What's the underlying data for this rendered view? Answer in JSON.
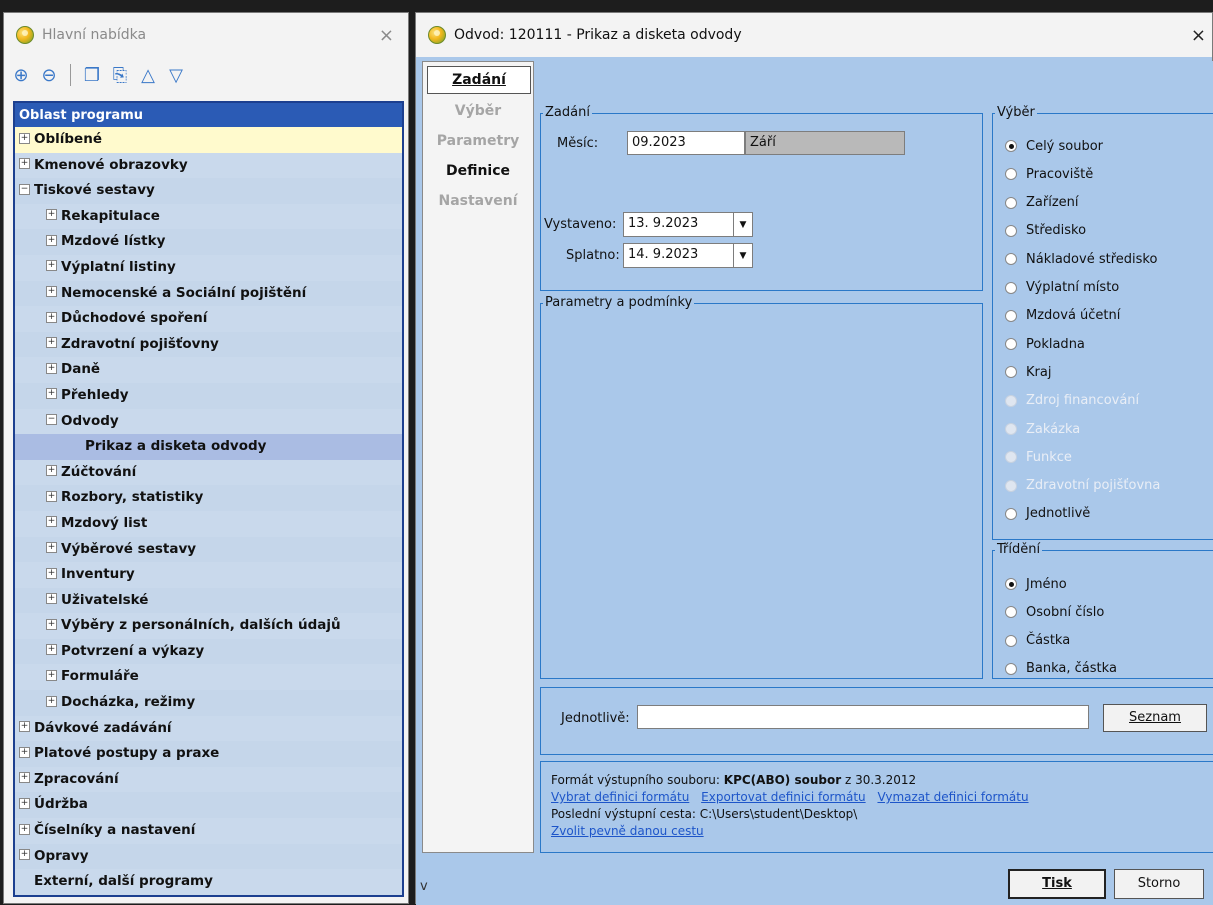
{
  "left_window": {
    "title": "Hlavní nabídka",
    "close": "×",
    "toolbar": [
      "expand-all-icon",
      "collapse-all-icon",
      "add-favorite-icon",
      "edit-favorite-icon",
      "move-up-icon",
      "move-down-icon"
    ],
    "tree_header": "Oblast programu",
    "tree": [
      {
        "label": "Oblíbené",
        "level": 0,
        "sign": "+"
      },
      {
        "label": "Kmenové obrazovky",
        "level": 0,
        "sign": "+"
      },
      {
        "label": "Tiskové sestavy",
        "level": 0,
        "sign": "−"
      },
      {
        "label": "Rekapitulace",
        "level": 1,
        "sign": "+"
      },
      {
        "label": "Mzdové lístky",
        "level": 1,
        "sign": "+"
      },
      {
        "label": "Výplatní listiny",
        "level": 1,
        "sign": "+"
      },
      {
        "label": "Nemocenské a Sociální pojištění",
        "level": 1,
        "sign": "+"
      },
      {
        "label": "Důchodové spoření",
        "level": 1,
        "sign": "+"
      },
      {
        "label": "Zdravotní pojišťovny",
        "level": 1,
        "sign": "+"
      },
      {
        "label": "Daně",
        "level": 1,
        "sign": "+"
      },
      {
        "label": "Přehledy",
        "level": 1,
        "sign": "+"
      },
      {
        "label": "Odvody",
        "level": 1,
        "sign": "−"
      },
      {
        "label": "Prikaz a disketa odvody",
        "level": 2,
        "sign": ""
      },
      {
        "label": "Zúčtování",
        "level": 1,
        "sign": "+"
      },
      {
        "label": "Rozbory, statistiky",
        "level": 1,
        "sign": "+"
      },
      {
        "label": "Mzdový list",
        "level": 1,
        "sign": "+"
      },
      {
        "label": "Výběrové sestavy",
        "level": 1,
        "sign": "+"
      },
      {
        "label": "Inventury",
        "level": 1,
        "sign": "+"
      },
      {
        "label": "Uživatelské",
        "level": 1,
        "sign": "+"
      },
      {
        "label": "Výběry z personálních, dalších údajů",
        "level": 1,
        "sign": "+"
      },
      {
        "label": "Potvrzení a výkazy",
        "level": 1,
        "sign": "+"
      },
      {
        "label": "Formuláře",
        "level": 1,
        "sign": "+"
      },
      {
        "label": "Docházka, režimy",
        "level": 1,
        "sign": "+"
      },
      {
        "label": "Dávkové zadávání",
        "level": 0,
        "sign": "+"
      },
      {
        "label": "Platové postupy a praxe",
        "level": 0,
        "sign": "+"
      },
      {
        "label": "Zpracování",
        "level": 0,
        "sign": "+"
      },
      {
        "label": "Údržba",
        "level": 0,
        "sign": "+"
      },
      {
        "label": "Číselníky a nastavení",
        "level": 0,
        "sign": "+"
      },
      {
        "label": "Opravy",
        "level": 0,
        "sign": "+"
      },
      {
        "label": "Externí, další programy",
        "level": 0,
        "sign": ""
      }
    ]
  },
  "dialog": {
    "title": "Odvod: 120111 - Prikaz a disketa odvody",
    "close": "×",
    "tabs": [
      "Zadání",
      "Výběr",
      "Parametry",
      "Definice",
      "Nastavení"
    ],
    "zadani": {
      "group_label": "Zadání",
      "mesic_label": "Měsíc:",
      "mesic_value": "09.2023",
      "mesic_name": "Září",
      "vystaveno_label": "Vystaveno:",
      "vystaveno_value": "13. 9.2023",
      "splatno_label": "Splatno:",
      "splatno_value": "14. 9.2023"
    },
    "parametry_label": "Parametry a podmínky",
    "vyber": {
      "group_label": "Výběr",
      "options": [
        {
          "label": "Celý soubor",
          "checked": true,
          "enabled": true
        },
        {
          "label": "Pracoviště",
          "checked": false,
          "enabled": true
        },
        {
          "label": "Zařízení",
          "checked": false,
          "enabled": true
        },
        {
          "label": "Středisko",
          "checked": false,
          "enabled": true
        },
        {
          "label": "Nákladové středisko",
          "checked": false,
          "enabled": true
        },
        {
          "label": "Výplatní místo",
          "checked": false,
          "enabled": true
        },
        {
          "label": "Mzdová účetní",
          "checked": false,
          "enabled": true
        },
        {
          "label": "Pokladna",
          "checked": false,
          "enabled": true
        },
        {
          "label": "Kraj",
          "checked": false,
          "enabled": true
        },
        {
          "label": "Zdroj financování",
          "checked": false,
          "enabled": false
        },
        {
          "label": "Zakázka",
          "checked": false,
          "enabled": false
        },
        {
          "label": "Funkce",
          "checked": false,
          "enabled": false
        },
        {
          "label": "Zdravotní pojišťovna",
          "checked": false,
          "enabled": false
        },
        {
          "label": "Jednotlivě",
          "checked": false,
          "enabled": true
        }
      ]
    },
    "trideni": {
      "group_label": "Třídění",
      "options": [
        {
          "label": "Jméno",
          "checked": true
        },
        {
          "label": "Osobní číslo",
          "checked": false
        },
        {
          "label": "Částka",
          "checked": false
        },
        {
          "label": "Banka, částka",
          "checked": false
        }
      ]
    },
    "jednotlive_label": "Jednotlivě:",
    "jednotlive_value": "",
    "seznam_button": "Seznam",
    "info": {
      "format_prefix": "Formát výstupního souboru:",
      "format_name": "KPC(ABO) soubor",
      "format_suffix": "z 30.3.2012",
      "links": [
        "Vybrat definici formátu",
        "Exportovat definici formátu",
        "Vymazat definici formátu"
      ],
      "path_line": "Poslední výstupní cesta: C:\\Users\\student\\Desktop\\",
      "fixed_path_link": "Zvolit pevně danou cestu"
    },
    "footer_letter": "v",
    "tisk_button": "Tisk",
    "storno_button": "Storno"
  }
}
